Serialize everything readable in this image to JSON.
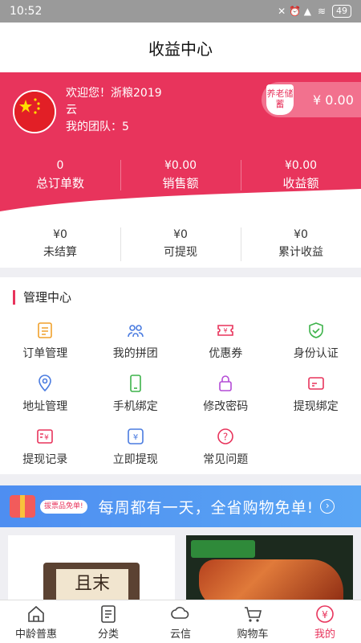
{
  "statusbar": {
    "time": "10:52",
    "battery": "49"
  },
  "header": {
    "title": "收益中心"
  },
  "user": {
    "greeting": "欢迎您！浙粮2019",
    "subtitle": "云",
    "team": "我的团队：5"
  },
  "savings": {
    "badge": "养老储蓄",
    "amount": "¥ 0.00"
  },
  "stats": [
    {
      "value": "0",
      "label": "总订单数"
    },
    {
      "value": "¥0.00",
      "label": "销售额"
    },
    {
      "value": "¥0.00",
      "label": "收益额"
    }
  ],
  "substats": [
    {
      "value": "¥0",
      "label": "未结算"
    },
    {
      "value": "¥0",
      "label": "可提现"
    },
    {
      "value": "¥0",
      "label": "累计收益"
    }
  ],
  "management": {
    "title": "管理中心",
    "items": [
      {
        "label": "订单管理",
        "icon": "order-list-icon",
        "color": "#f0a12c"
      },
      {
        "label": "我的拼团",
        "icon": "group-icon",
        "color": "#4a7be0"
      },
      {
        "label": "优惠券",
        "icon": "coupon-icon",
        "color": "#e8345c"
      },
      {
        "label": "身份认证",
        "icon": "id-verify-icon",
        "color": "#3db34a"
      },
      {
        "label": "地址管理",
        "icon": "location-icon",
        "color": "#4a7be0"
      },
      {
        "label": "手机绑定",
        "icon": "phone-icon",
        "color": "#3db34a"
      },
      {
        "label": "修改密码",
        "icon": "lock-icon",
        "color": "#b44bd6"
      },
      {
        "label": "提现绑定",
        "icon": "card-icon",
        "color": "#e8345c"
      },
      {
        "label": "提现记录",
        "icon": "record-icon",
        "color": "#e8345c"
      },
      {
        "label": "立即提现",
        "icon": "withdraw-icon",
        "color": "#4a7be0"
      },
      {
        "label": "常见问题",
        "icon": "question-icon",
        "color": "#e8345c"
      }
    ]
  },
  "banner": {
    "bubble": "拔票品免单!",
    "text": "每周都有一天，全省购物免单!"
  },
  "products": [
    {
      "label": "且末"
    },
    {
      "label": ""
    }
  ],
  "tabs": [
    {
      "label": "中龄普惠",
      "icon": "home-icon"
    },
    {
      "label": "分类",
      "icon": "category-icon"
    },
    {
      "label": "云信",
      "icon": "cloud-chat-icon"
    },
    {
      "label": "购物车",
      "icon": "cart-icon"
    },
    {
      "label": "我的",
      "icon": "yen-circle-icon",
      "active": true
    }
  ],
  "colors": {
    "accent": "#e8345c",
    "banner": "#4e8ef1"
  }
}
